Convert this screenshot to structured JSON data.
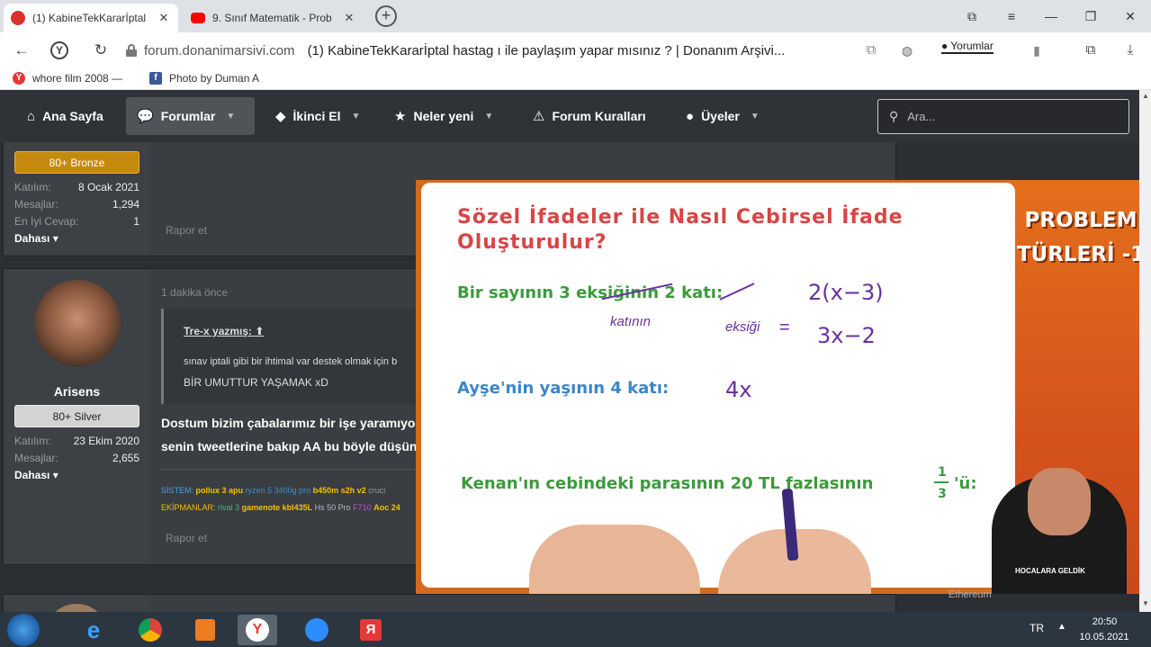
{
  "tabs": [
    {
      "label": "(1) KabineTekKararİptal",
      "icon_color": "#d9342b",
      "active": true
    },
    {
      "label": "9. Sınıf Matematik - Prob",
      "icon_color": "#ff0000",
      "active": false
    }
  ],
  "address": {
    "domain": "forum.donanimarsivi.com",
    "page_title": "(1) KabineTekKararİptal hastag ı ile paylaşım yapar mısınız ? | Donanım Arşivi...",
    "comments_label": "Yorumlar"
  },
  "bookmarks": [
    {
      "label": "whore film 2008 —",
      "icon": "Y"
    },
    {
      "label": "Photo by Duman A",
      "icon": "f"
    }
  ],
  "nav": {
    "items": [
      {
        "label": "Ana Sayfa",
        "icon": "home-icon"
      },
      {
        "label": "Forumlar",
        "icon": "chat-icon"
      },
      {
        "label": "İkinci El",
        "icon": "tag-icon"
      },
      {
        "label": "Neler yeni",
        "icon": "star-icon"
      },
      {
        "label": "Forum Kuralları",
        "icon": "warning-icon"
      },
      {
        "label": "Üyeler",
        "icon": "user-icon"
      }
    ],
    "search_placeholder": "Ara..."
  },
  "post1": {
    "rank": "80+ Bronze",
    "stats": [
      {
        "k": "Katılım:",
        "v": "8 Ocak 2021"
      },
      {
        "k": "Mesajlar:",
        "v": "1,294"
      },
      {
        "k": "En İyi Cevap:",
        "v": "1"
      }
    ],
    "more": "Dahası",
    "report": "Rapor et"
  },
  "post2": {
    "username": "Arisens",
    "rank": "80+ Silver",
    "stats": [
      {
        "k": "Katılım:",
        "v": "23 Ekim 2020"
      },
      {
        "k": "Mesajlar:",
        "v": "2,655"
      }
    ],
    "more": "Dahası",
    "time": "1 dakika önce",
    "quote_author": "Tre-x yazmış:",
    "quote_line1": "sınav iptali gibi bir ihtimal var destek olmak için b",
    "quote_line2": "BİR UMUTTUR YAŞAMAK xD",
    "message_line1": "Dostum bizim çabalarımız bir işe yaramıyor",
    "message_line2": "senin tweetlerine bakıp AA bu böyle düşün",
    "sig_line1_label": "SİSTEM:",
    "sig_line1_items": [
      "pollux 3 apu",
      "ryzen 5 3400g pro",
      "b450m s2h v2",
      "cruci"
    ],
    "sig_line2_label": "EKİPMANLAR:",
    "sig_line2_items": [
      "rival 3",
      "gamenote kbl435L",
      "Hs 50 Pro",
      "F710",
      "Aoc 24"
    ],
    "report": "Rapor et"
  },
  "video": {
    "title_line1": "Sözel İfadeler ile Nasıl Cebirsel İfade",
    "title_line2": "Oluşturulur?",
    "row1_text": "Bir sayının 3 eksiğinin 2 katı:",
    "row1_answer": "2(x−3)",
    "row1_note1": "katının",
    "row1_note2": "eksiği",
    "row1_answer2": "3x−2",
    "row2_text": "Ayşe'nin yaşının 4 katı:",
    "row2_answer": "4x",
    "row3_text": "Kenan'ın cebindeki parasının 20 TL fazlasının",
    "row3_frac_num": "1",
    "row3_frac_den": "3",
    "row3_suffix": "'ü:",
    "banner_line1": "PROBLEM",
    "banner_line2": "TÜRLERİ -1",
    "shirt_text": "HOCALARA GELDİK",
    "username_peek": "Ethereum"
  },
  "taskbar": {
    "lang": "TR",
    "time": "20:50",
    "date": "10.05.2021"
  }
}
